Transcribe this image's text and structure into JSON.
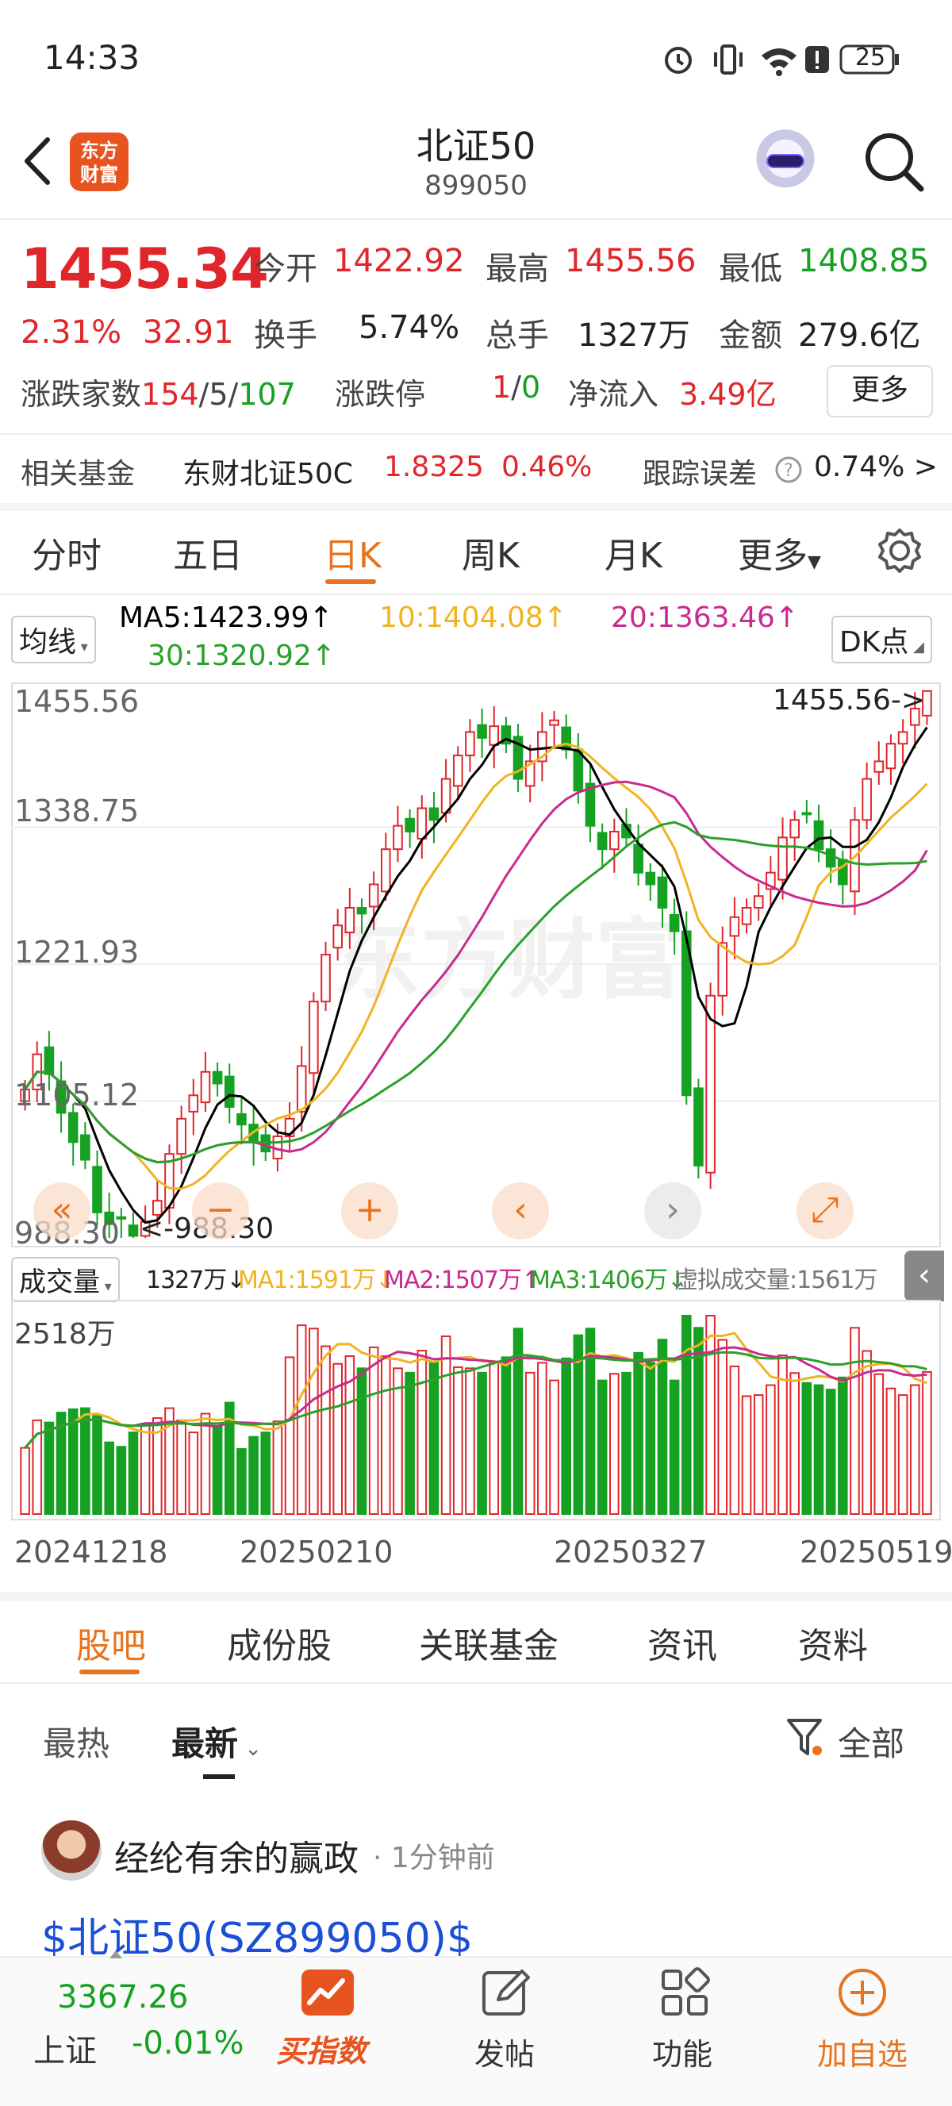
{
  "status_bar": {
    "time": "14:33",
    "battery": "25"
  },
  "header": {
    "title": "北证50",
    "code": "899050",
    "logo_text_1": "东方",
    "logo_text_2": "财富"
  },
  "quote": {
    "price": "1455.34",
    "change_pct": "2.31%",
    "change": "32.91",
    "open_label": "今开",
    "open": "1422.92",
    "high_label": "最高",
    "high": "1455.56",
    "low_label": "最低",
    "low": "1408.85",
    "turnover_label": "换手",
    "turnover": "5.74%",
    "volume_label": "总手",
    "volume": "1327万",
    "amount_label": "金额",
    "amount": "279.6亿",
    "breadth_label": "涨跌家数",
    "breadth_up": "154",
    "breadth_sep1": "/",
    "breadth_flat": "5",
    "breadth_sep2": "/",
    "breadth_down": "107",
    "limit_label": "涨跌停",
    "limit_up": "1",
    "limit_sep": "/",
    "limit_down": "0",
    "inflow_label": "净流入",
    "inflow": "3.49亿",
    "more_label": "更多"
  },
  "fund": {
    "label": "相关基金",
    "name": "东财北证50C",
    "price": "1.8325",
    "pct": "0.46%",
    "error_label": "跟踪误差",
    "error_value": "0.74% >"
  },
  "chart_tabs": [
    "分时",
    "五日",
    "日K",
    "周K",
    "月K",
    "更多"
  ],
  "chart_tabs_active": 2,
  "ma_bar": {
    "dropdown": "均线",
    "ma5": "MA5:1423.99↑",
    "ma10": "10:1404.08↑",
    "ma20": "20:1363.46↑",
    "ma30": "30:1320.92↑",
    "dk": "DK点"
  },
  "price_axis": {
    "labels": [
      "1455.56",
      "1338.75",
      "1221.93",
      "1105.12",
      "988.30"
    ],
    "max_marker": "1455.56->",
    "min_marker": "<-988.30"
  },
  "volume_bar": {
    "dropdown": "成交量",
    "vol": "1327万↓",
    "ma1": "MA1:1591万↓",
    "ma2": "MA2:1507万↑",
    "ma3": "MA3:1406万↓",
    "virtual": "虚拟成交量:1561万",
    "axis_max": "2518万"
  },
  "date_axis": [
    "20241218",
    "20250210",
    "20250327",
    "20250519"
  ],
  "watermark": "东方财富",
  "colors": {
    "up": "#e0262b",
    "down": "#16a123",
    "accent": "#e8731f",
    "ma5": "#000000",
    "ma10": "#f0b323",
    "ma20": "#c92a8e",
    "ma30": "#2aa12a"
  },
  "chart_data": {
    "type": "candlestick",
    "ylim": [
      988.3,
      1455.56
    ],
    "x_ticks": [
      "20241218",
      "20250210",
      "20250327",
      "20250519"
    ],
    "notes": "Daily K-line of 北证50; approximate closes traced from chart",
    "closes": [
      1115,
      1145,
      1128,
      1095,
      1070,
      1055,
      1010,
      1000,
      1005,
      990,
      1002,
      1020,
      1060,
      1090,
      1110,
      1130,
      1120,
      1100,
      1085,
      1070,
      1062,
      1075,
      1090,
      1135,
      1190,
      1230,
      1255,
      1270,
      1265,
      1290,
      1320,
      1340,
      1335,
      1355,
      1345,
      1380,
      1400,
      1420,
      1415,
      1425,
      1410,
      1380,
      1395,
      1420,
      1430,
      1405,
      1370,
      1340,
      1320,
      1335,
      1330,
      1300,
      1290,
      1270,
      1250,
      1110,
      1050,
      1195,
      1240,
      1262,
      1270,
      1280,
      1300,
      1330,
      1345,
      1350,
      1320,
      1305,
      1290,
      1345,
      1380,
      1395,
      1410,
      1420,
      1440,
      1455
    ],
    "volume_ylim": [
      0,
      2518
    ],
    "volume_unit": "万"
  },
  "bottom_tabs": [
    "股吧",
    "成份股",
    "关联基金",
    "资讯",
    "资料"
  ],
  "bottom_tabs_active": 0,
  "feed_sort": {
    "hot": "最热",
    "new": "最新",
    "filter": "全部"
  },
  "post": {
    "user": "经纶有余的赢政",
    "time": "· 1分钟前",
    "text": "$北证50(SZ899050)$"
  },
  "bottom_nav": {
    "index_value": "3367.26",
    "index_name": "上证",
    "index_change": "-0.01%",
    "buy_index": "买指数",
    "post": "发帖",
    "functions": "功能",
    "add_watch": "加自选"
  }
}
